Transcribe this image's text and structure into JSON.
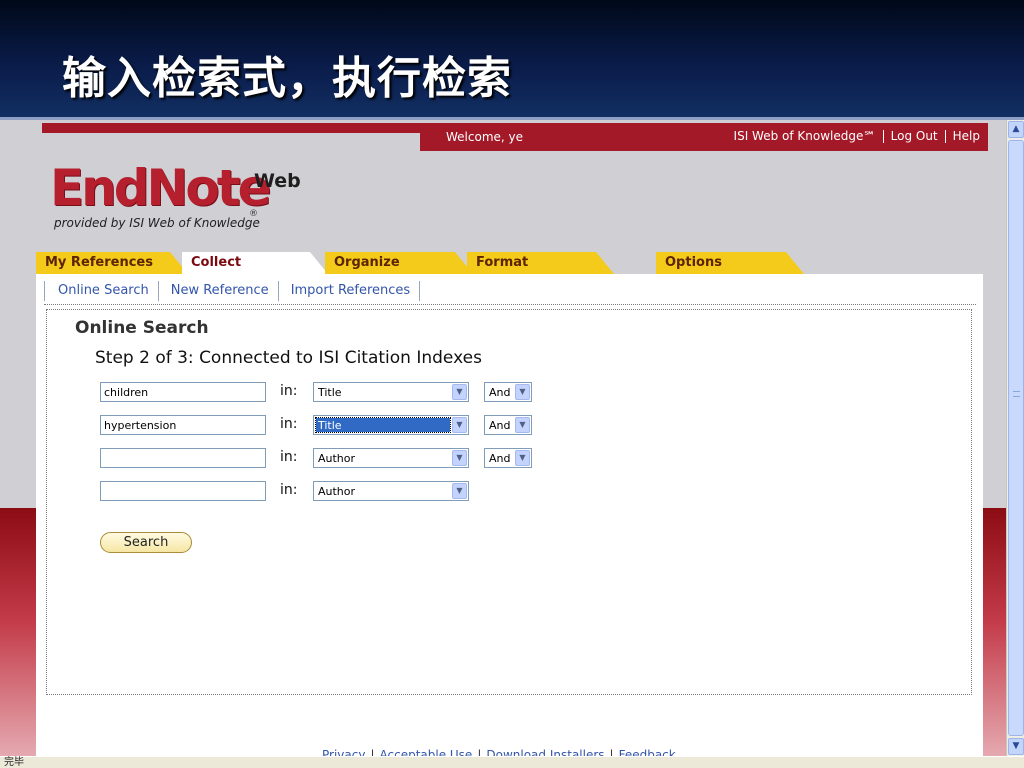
{
  "slide": {
    "title": "输入检索式，执行检索"
  },
  "header": {
    "welcome": "Welcome, ye",
    "links": [
      "ISI Web of Knowledge℠",
      "Log Out",
      "Help"
    ]
  },
  "logo": {
    "main": "EndNote",
    "suffix": "Web",
    "reg": "®",
    "tagline": "provided by ISI Web of Knowledge"
  },
  "tabs": [
    {
      "label": "My References",
      "active": false
    },
    {
      "label": "Collect",
      "active": true
    },
    {
      "label": "Organize",
      "active": false
    },
    {
      "label": "Format",
      "active": false
    },
    {
      "label": "Options",
      "active": false
    }
  ],
  "subnav": [
    "Online Search",
    "New Reference",
    "Import References"
  ],
  "search": {
    "title": "Online Search",
    "step": "Step 2 of 3: Connected to ISI Citation Indexes",
    "in_label": "in:",
    "rows": [
      {
        "term": "children",
        "field": "Title",
        "bool": "And"
      },
      {
        "term": "hypertension",
        "field": "Title",
        "field_highlighted": true,
        "bool": "And"
      },
      {
        "term": "",
        "field": "Author",
        "bool": "And"
      },
      {
        "term": "",
        "field": "Author"
      }
    ],
    "button": "Search"
  },
  "footer": {
    "links": [
      "Privacy",
      "Acceptable Use",
      "Download Installers",
      "Feedback"
    ]
  },
  "statusbar": {
    "text": "完毕"
  },
  "icons": {
    "scroll_up": "up-arrow-icon",
    "scroll_down": "down-arrow-icon",
    "dropdown": "chevron-down-icon"
  },
  "colors": {
    "brand_red": "#a31928",
    "tab_yellow": "#f4cb1a",
    "link_blue": "#3355aa",
    "slide_blue": "#0a1c4a"
  }
}
